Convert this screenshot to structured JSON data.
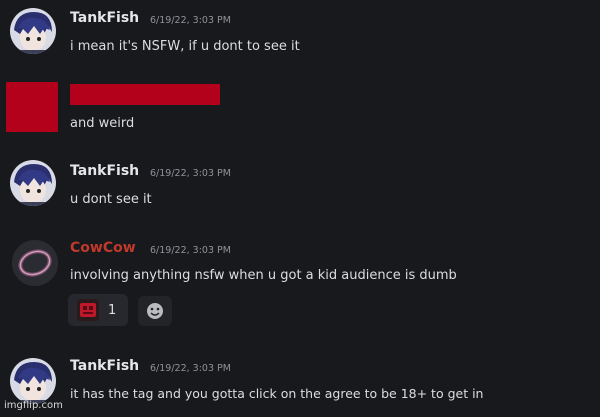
{
  "messages": [
    {
      "author": "TankFish",
      "timestamp": "6/19/22, 3:03 PM",
      "text": "i mean it's NSFW, if u dont to see it",
      "author_color": "#e4e6ea"
    },
    {
      "author_redacted": true,
      "text": "and weird",
      "redaction_color": "#b3001b"
    },
    {
      "author": "TankFish",
      "timestamp": "6/19/22, 3:03 PM",
      "text": "u dont see it",
      "author_color": "#e4e6ea"
    },
    {
      "author": "CowCow",
      "timestamp": "6/19/22, 3:03 PM",
      "text": "involving anything nsfw when u got a kid audience is dumb",
      "author_color": "#c0392b",
      "reaction": {
        "count": "1",
        "icon": "red-emoji-icon"
      }
    },
    {
      "author": "TankFish",
      "timestamp": "6/19/22, 3:03 PM",
      "text": "it has the tag and you gotta click on the agree to be 18+ to get in",
      "author_color": "#e4e6ea"
    }
  ],
  "watermark": "imgflip.com",
  "colors": {
    "background": "#18191c",
    "text": "#dcddde",
    "timestamp": "#8e9297",
    "redaction": "#b3001b"
  }
}
